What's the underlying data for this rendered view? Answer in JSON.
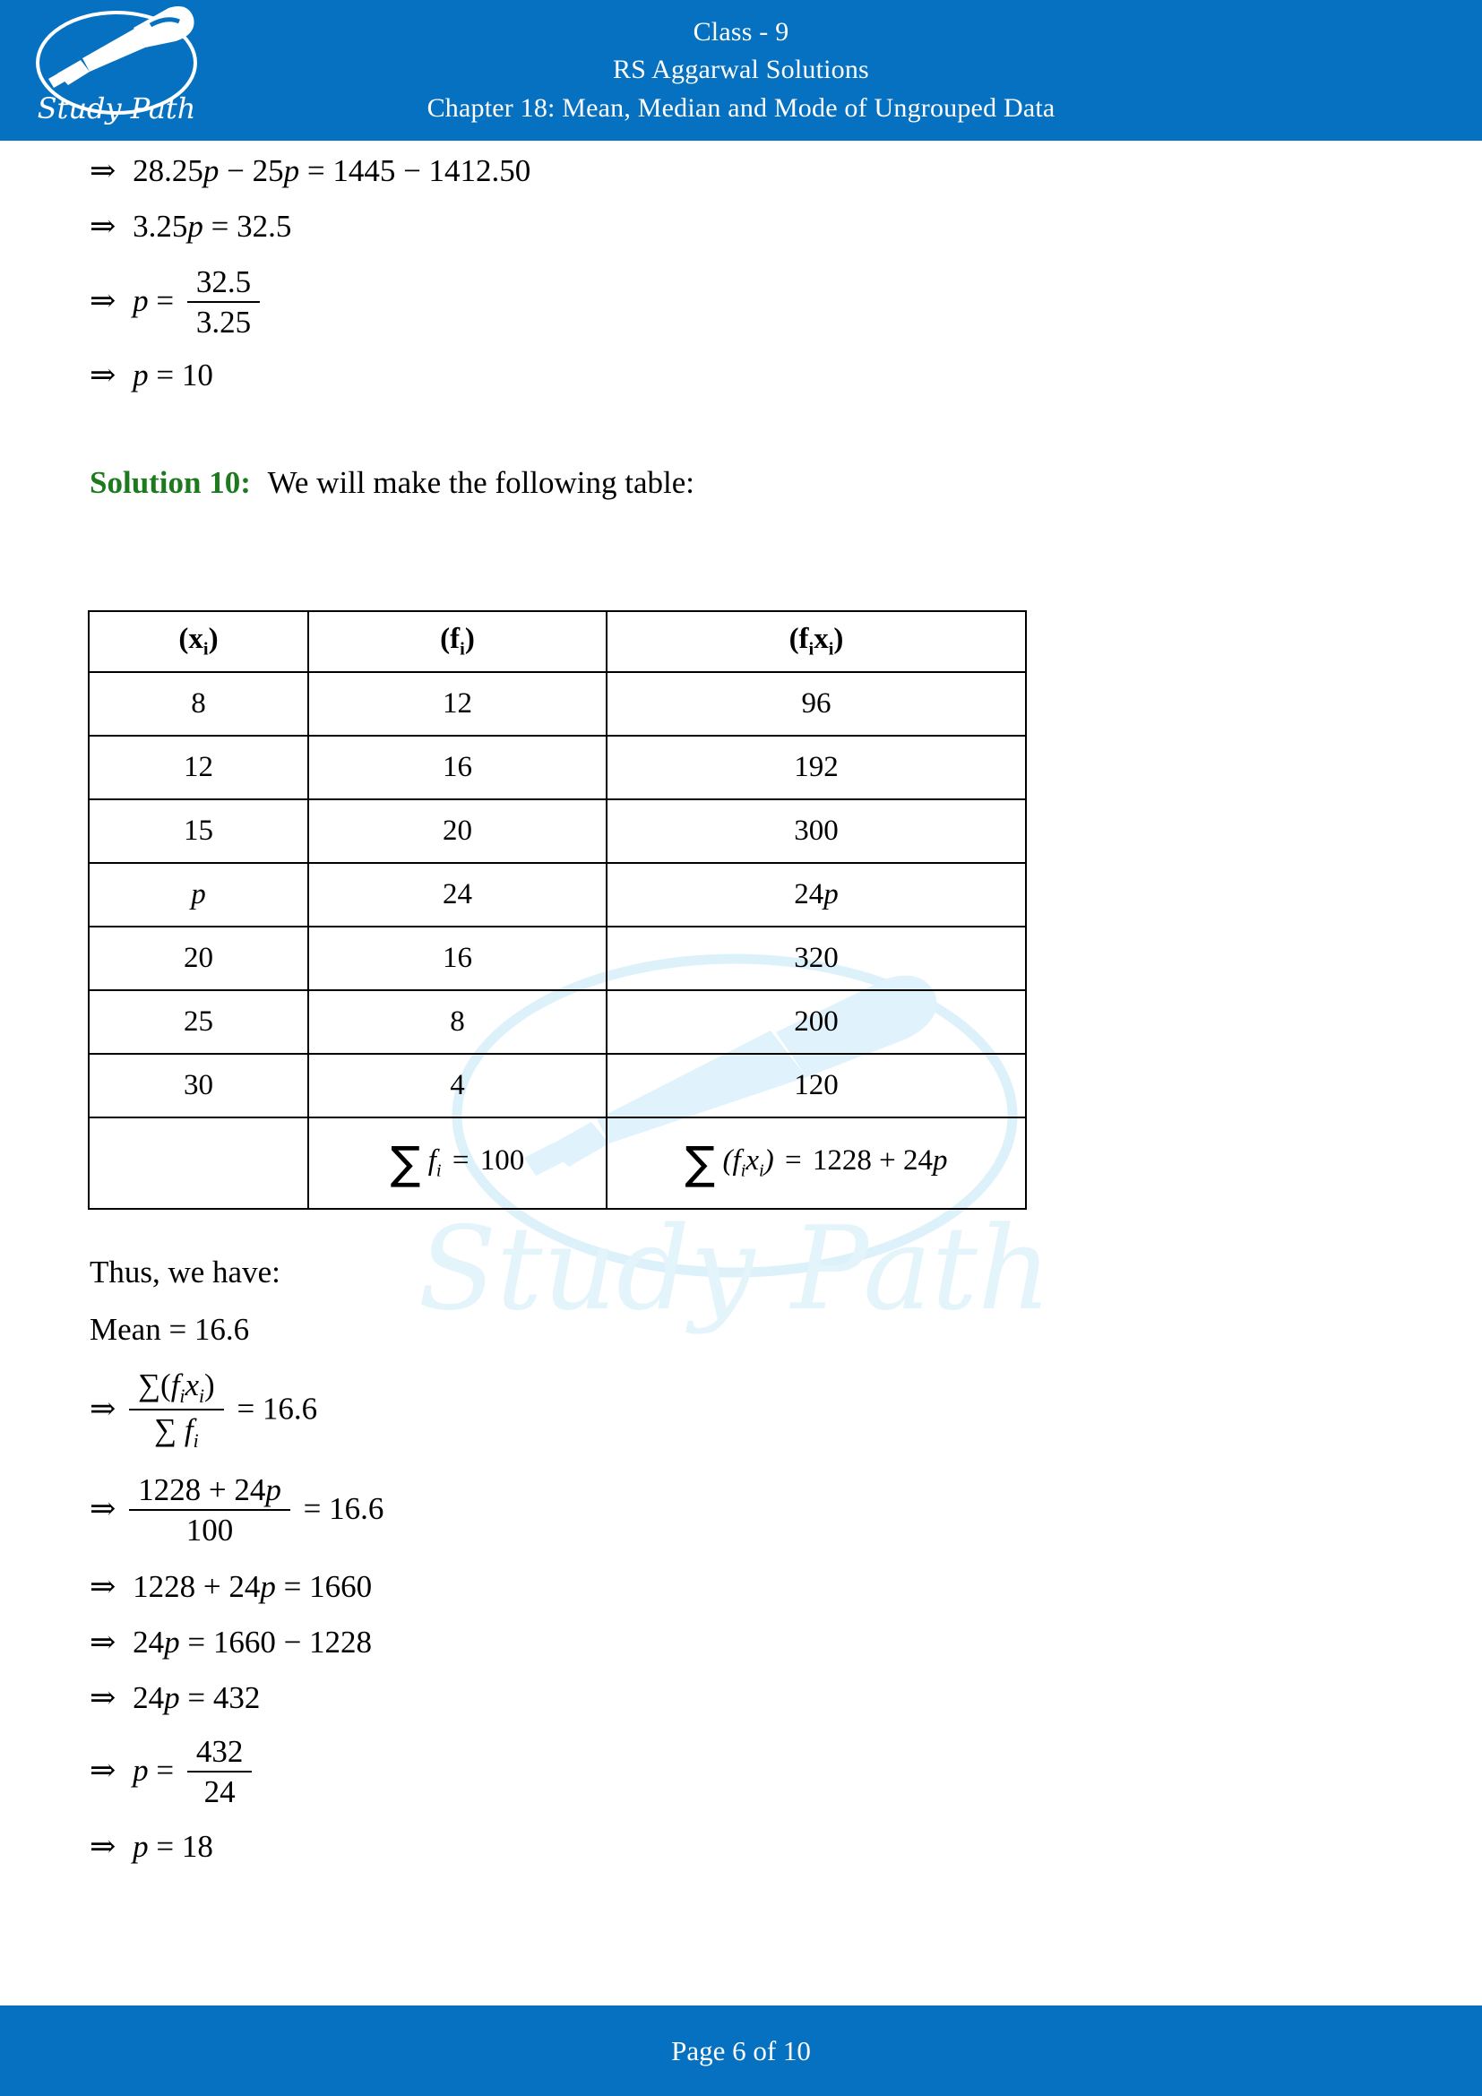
{
  "header": {
    "line1": "Class - 9",
    "line2": "RS Aggarwal Solutions",
    "line3": "Chapter 18: Mean, Median and Mode of Ungrouped Data",
    "logo_text": "Study Path",
    "bar_color": "#0571c0",
    "text_color": "#ffffff"
  },
  "watermark": {
    "text": "Study Path",
    "color": "#e4f4fb"
  },
  "top_equations": [
    {
      "id": "eq1",
      "arrow": "⇒",
      "text": "28.25p − 25p = 1445 − 1412.50"
    },
    {
      "id": "eq2",
      "arrow": "⇒",
      "text": "3.25p = 32.5"
    },
    {
      "id": "eq3",
      "arrow": "⇒",
      "lhs": "p =",
      "numerator": "32.5",
      "denominator": "3.25"
    },
    {
      "id": "eq4",
      "arrow": "⇒",
      "text": "p = 10"
    }
  ],
  "solution": {
    "label": "Solution 10:",
    "label_color": "#1e7a1e",
    "intro": "We will make the following table:"
  },
  "table": {
    "headers": [
      "(xᵢ)",
      "(fᵢ)",
      "(fᵢxᵢ)"
    ],
    "header_parts": [
      {
        "open": "(",
        "base": "x",
        "sub": "i",
        "close": ")"
      },
      {
        "open": "(",
        "base": "f",
        "sub": "i",
        "close": ")"
      },
      {
        "open": "(",
        "base1": "f",
        "sub1": "i",
        "base2": "x",
        "sub2": "i",
        "close": ")"
      }
    ],
    "rows": [
      {
        "xi": "8",
        "fi": "12",
        "fixi": "96"
      },
      {
        "xi": "12",
        "fi": "16",
        "fixi": "192"
      },
      {
        "xi": "15",
        "fi": "20",
        "fixi": "300"
      },
      {
        "xi": "p",
        "fi": "24",
        "fixi": "24p"
      },
      {
        "xi": "20",
        "fi": "16",
        "fixi": "320"
      },
      {
        "xi": "25",
        "fi": "8",
        "fixi": "200"
      },
      {
        "xi": "30",
        "fi": "4",
        "fixi": "120"
      }
    ],
    "total_row": {
      "xi": "",
      "fi_label": "∑ fᵢ = 100",
      "fi_value": "100",
      "fixi_label": "∑ (fᵢxᵢ) = 1228 + 24p",
      "fixi_value": "1228 + 24p"
    }
  },
  "bottom": {
    "thus_line": "Thus, we have:",
    "mean_line": "Mean = 16.6",
    "eq_frac_sum": {
      "arrow": "⇒",
      "numerator": "∑(fᵢxᵢ)",
      "denominator": "∑ fᵢ",
      "rhs": "= 16.6"
    },
    "eq_frac_num": {
      "arrow": "⇒",
      "numerator": "1228 + 24p",
      "denominator": "100",
      "rhs": "= 16.6"
    },
    "equations": [
      {
        "id": "beq1",
        "arrow": "⇒",
        "text": "1228 + 24p = 1660"
      },
      {
        "id": "beq2",
        "arrow": "⇒",
        "text": "24p = 1660 − 1228"
      },
      {
        "id": "beq3",
        "arrow": "⇒",
        "text": "24p = 432"
      }
    ],
    "eq_frac_final": {
      "arrow": "⇒",
      "lhs": "p =",
      "numerator": "432",
      "denominator": "24"
    },
    "final_line": {
      "arrow": "⇒",
      "text": "p = 18"
    }
  },
  "footer": {
    "text": "Page 6 of 10",
    "page_current": "6",
    "page_total": "10",
    "bar_color": "#0571c0"
  }
}
